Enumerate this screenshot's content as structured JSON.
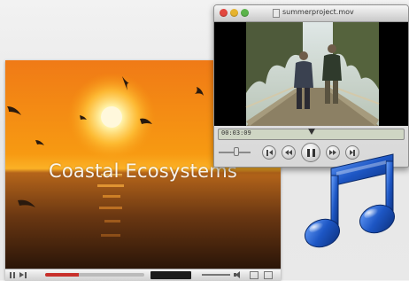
{
  "card": {
    "title": "Coastal Ecosystems",
    "playback_progress": 0.34
  },
  "player": {
    "window_title": "summerproject.mov",
    "current_time": "00:03:09",
    "playhead_position": 0.5,
    "volume_level": 0.55
  },
  "icons": {
    "music": "music-note-icon"
  },
  "colors": {
    "sunset_sky": "#f28a12",
    "sun": "#fff8d6",
    "note_blue": "#1a4fb0",
    "progress_red": "#c8302b"
  }
}
